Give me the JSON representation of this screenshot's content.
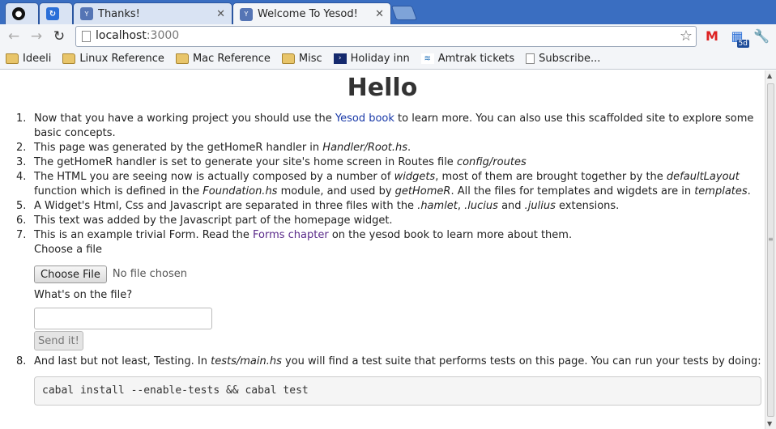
{
  "tabs": [
    {
      "title": "",
      "icon": "github-icon"
    },
    {
      "title": "",
      "icon": "calendar-app-icon"
    },
    {
      "title": "Thanks!",
      "icon": "yesod-icon"
    },
    {
      "title": "Welcome To Yesod!",
      "icon": "yesod-icon",
      "active": true
    }
  ],
  "toolbar": {
    "url_host": "localhost",
    "url_port": ":3000",
    "calendar_badge": "5d"
  },
  "bookmarks": [
    {
      "label": "Ideeli",
      "icon": "folder-icon"
    },
    {
      "label": "Linux Reference",
      "icon": "folder-icon"
    },
    {
      "label": "Mac Reference",
      "icon": "folder-icon"
    },
    {
      "label": "Misc",
      "icon": "folder-icon"
    },
    {
      "label": "Holiday inn",
      "icon": "holiday-inn-icon"
    },
    {
      "label": "Amtrak tickets",
      "icon": "amtrak-icon"
    },
    {
      "label": "Subscribe...",
      "icon": "document-icon"
    }
  ],
  "page": {
    "heading": "Hello",
    "item1": {
      "a": "Now that you have a working project you should use the ",
      "link": "Yesod book",
      "b": " to learn more. You can also use this scaffolded site to explore some basic concepts."
    },
    "item2": {
      "a": "This page was generated by the getHomeR handler in ",
      "em": "Handler/Root.hs",
      "b": "."
    },
    "item3": {
      "a": "The getHomeR handler is set to generate your site's home screen in Routes file ",
      "em": "config/routes"
    },
    "item4": {
      "a": "The HTML you are seeing now is actually composed by a number of ",
      "em1": "widgets",
      "b": ", most of them are brought together by the ",
      "em2": "defaultLayout",
      "c": " function which is defined in the ",
      "em3": "Foundation.hs",
      "d": " module, and used by ",
      "em4": "getHomeR",
      "e": ". All the files for templates and wigdets are in ",
      "em5": "templates",
      "f": "."
    },
    "item5": {
      "a": "A Widget's Html, Css and Javascript are separated in three files with the ",
      "em1": ".hamlet",
      "b": ", ",
      "em2": ".lucius",
      "c": " and ",
      "em3": ".julius",
      "d": " extensions."
    },
    "item6": "This text was added by the Javascript part of the homepage widget.",
    "item7": {
      "a": "This is an example trivial Form. Read the ",
      "link": "Forms chapter",
      "b": " on the yesod book to learn more about them."
    },
    "form": {
      "file_label": "Choose a file",
      "file_button": "Choose File",
      "file_status": "No file chosen",
      "question_label": "What's on the file?",
      "text_value": "",
      "submit_label": "Send it!"
    },
    "item8": {
      "a": "And last but not least, Testing. In ",
      "em": "tests/main.hs",
      "b": " you will find a test suite that performs tests on this page. You can run your tests by doing:"
    },
    "code": "cabal install --enable-tests && cabal test"
  }
}
